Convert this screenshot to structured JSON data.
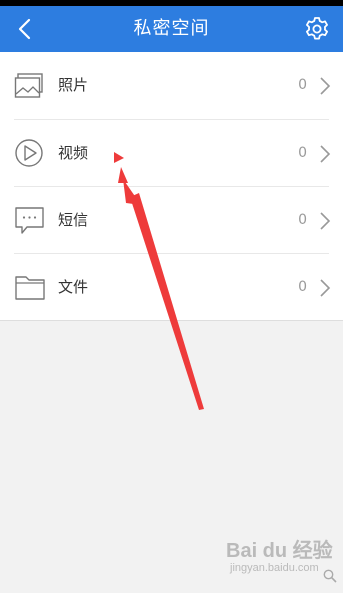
{
  "header": {
    "title": "私密空间",
    "back_icon": "chevron-left-icon",
    "settings_icon": "gear-icon",
    "background_color": "#2d7de0"
  },
  "items": [
    {
      "label": "照片",
      "count": "0",
      "icon": "photo-stack-icon"
    },
    {
      "label": "视频",
      "count": "0",
      "icon": "play-circle-icon"
    },
    {
      "label": "短信",
      "count": "0",
      "icon": "chat-bubble-icon"
    },
    {
      "label": "文件",
      "count": "0",
      "icon": "folder-icon"
    }
  ],
  "annotation": {
    "color": "#ee3b3b"
  },
  "watermark": {
    "brand": "Bai du 经验",
    "domain": "jingyan.baidu.com"
  }
}
